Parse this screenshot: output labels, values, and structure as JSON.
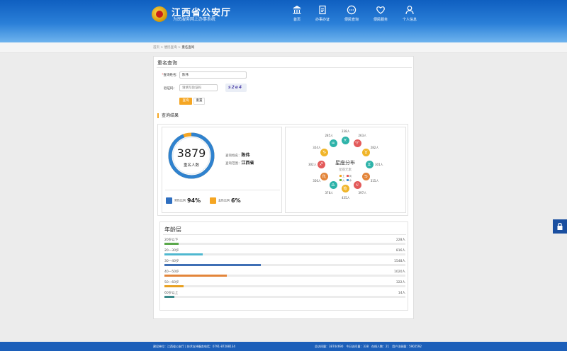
{
  "header": {
    "title": "江西省公安厅",
    "subtitle": "为民服务网上办事系统",
    "nav": [
      {
        "label": "首页",
        "icon": "bank-icon"
      },
      {
        "label": "办事办证",
        "icon": "document-icon"
      },
      {
        "label": "便民查询",
        "icon": "chat-icon"
      },
      {
        "label": "便民服务",
        "icon": "heart-icon"
      },
      {
        "label": "个人信息",
        "icon": "user-icon"
      }
    ]
  },
  "breadcrumb": {
    "home": "首页",
    "sep": ">",
    "mid": "便民查询",
    "current": "重名查询"
  },
  "main": {
    "title": "重名查询",
    "form": {
      "name_label": "查询姓名：",
      "name_required": "*",
      "name_value": "陈伟",
      "captcha_label": "验证码：",
      "captcha_placeholder": "请填写验证码",
      "captcha_text": "s2e4",
      "query_button": "查询",
      "reset_button": "重置"
    },
    "result": {
      "title": "查询结果",
      "total": "3879",
      "total_caption": "重名人数",
      "male_ratio_fraction": 0.94,
      "info_name_label": "查询姓名：",
      "info_name_value": "陈伟",
      "info_region_label": "查询范围：",
      "info_region_value": "江西省",
      "male_label": "男性比例",
      "male_value": "94%",
      "female_label": "女性比例",
      "female_value": "6%"
    },
    "zodiac": {
      "title": "星座分布",
      "subtitle": "星座元素",
      "legend": [
        "土",
        "风",
        "火",
        "水"
      ],
      "legend_colors": [
        "#f5a623",
        "#e65a5a",
        "#6db33f",
        "#3a8fd8"
      ],
      "items": [
        {
          "sign": "♓",
          "count": "238人",
          "color": "#2db3a9"
        },
        {
          "sign": "♈",
          "count": "263人",
          "color": "#e35a5a"
        },
        {
          "sign": "♉",
          "count": "282人",
          "color": "#f0b529"
        },
        {
          "sign": "♊",
          "count": "301人",
          "color": "#2db3a9"
        },
        {
          "sign": "♋",
          "count": "315人",
          "color": "#e3853a"
        },
        {
          "sign": "♌",
          "count": "397人",
          "color": "#e35a5a"
        },
        {
          "sign": "♍",
          "count": "435人",
          "color": "#f0b529"
        },
        {
          "sign": "♎",
          "count": "378人",
          "color": "#2db3a9"
        },
        {
          "sign": "♏",
          "count": "356人",
          "color": "#e3853a"
        },
        {
          "sign": "♐",
          "count": "302人",
          "color": "#e35a5a"
        },
        {
          "sign": "♑",
          "count": "324人",
          "color": "#f0b529"
        },
        {
          "sign": "♒",
          "count": "285人",
          "color": "#2db3a9"
        }
      ],
      "top_sign": "♓"
    },
    "age": {
      "title": "年龄层",
      "rows": [
        {
          "label": "20岁以下",
          "count": "228人",
          "fraction": 0.06,
          "color": "#5aa84a"
        },
        {
          "label": "20—30岁",
          "count": "816人",
          "fraction": 0.16,
          "color": "#4fb8d0"
        },
        {
          "label": "30—40岁",
          "count": "1548人",
          "fraction": 0.4,
          "color": "#3f6fb5"
        },
        {
          "label": "40—50岁",
          "count": "1020人",
          "fraction": 0.26,
          "color": "#e3853a"
        },
        {
          "label": "50—60岁",
          "count": "322人",
          "fraction": 0.08,
          "color": "#e8a020"
        },
        {
          "label": "60岁以上",
          "count": "14人",
          "fraction": 0.04,
          "color": "#3a8a8a"
        }
      ]
    }
  },
  "footer": {
    "left": "建设单位：江西省公安厅 | 技术支持服务电话：0791-87288134",
    "right": "总访问量：38744690　今日访问量：338　在线人数：21　用户注册量：5902592"
  }
}
